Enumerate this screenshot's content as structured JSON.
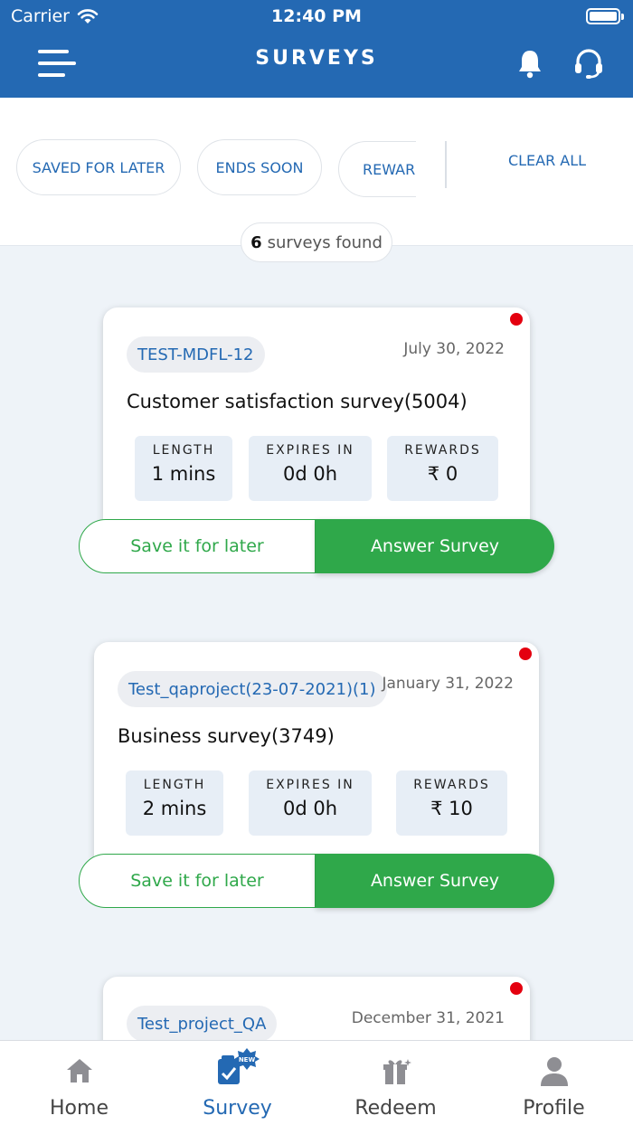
{
  "status_bar": {
    "carrier": "Carrier",
    "time": "12:40 PM"
  },
  "header": {
    "title": "SURVEYS",
    "menu_icon": "hamburger-menu-icon",
    "bell_icon": "bell-icon",
    "support_icon": "headset-icon"
  },
  "filters": {
    "chips": [
      "SAVED FOR LATER",
      "ENDS SOON",
      "REWAR"
    ],
    "clear_all": "CLEAR ALL"
  },
  "results": {
    "count": "6",
    "label": "surveys found"
  },
  "surveys": [
    {
      "project": "TEST-MDFL-12",
      "date": "July 30, 2022",
      "title": "Customer satisfaction survey(5004)",
      "length_label": "LENGTH",
      "length": "1 mins",
      "expires_label": "EXPIRES IN",
      "expires": "0d 0h",
      "rewards_label": "REWARDS",
      "rewards": "₹ 0",
      "save_label": "Save it for later",
      "answer_label": "Answer Survey"
    },
    {
      "project": "Test_qaproject(23-07-2021)(1)",
      "date": "January 31, 2022",
      "title": "Business survey(3749)",
      "length_label": "LENGTH",
      "length": "2 mins",
      "expires_label": "EXPIRES IN",
      "expires": "0d 0h",
      "rewards_label": "REWARDS",
      "rewards": "₹ 10",
      "save_label": "Save it for later",
      "answer_label": "Answer Survey"
    },
    {
      "project": "Test_project_QA",
      "date": "December 31, 2021"
    }
  ],
  "tabbar": {
    "tabs": [
      {
        "label": "Home",
        "icon": "home-icon"
      },
      {
        "label": "Survey",
        "icon": "survey-new-icon",
        "badge": "NEW",
        "active": true
      },
      {
        "label": "Redeem",
        "icon": "gift-icon"
      },
      {
        "label": "Profile",
        "icon": "profile-icon"
      }
    ]
  },
  "colors": {
    "primary": "#2469b3",
    "green": "#2fa84a",
    "unread_dot": "#e4000f"
  }
}
